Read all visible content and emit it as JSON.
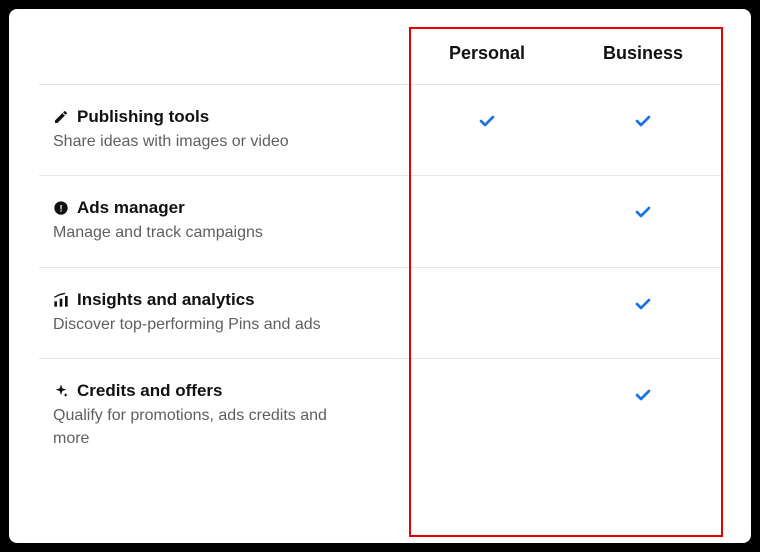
{
  "columns": {
    "personal": "Personal",
    "business": "Business"
  },
  "features": [
    {
      "icon": "pencil-icon",
      "title": "Publishing tools",
      "subtitle": "Share ideas with images or video",
      "personal": true,
      "business": true
    },
    {
      "icon": "megaphone-icon",
      "title": "Ads manager",
      "subtitle": "Manage and track campaigns",
      "personal": false,
      "business": true
    },
    {
      "icon": "analytics-icon",
      "title": "Insights and analytics",
      "subtitle": "Discover top-performing Pins and ads",
      "personal": false,
      "business": true
    },
    {
      "icon": "sparkle-icon",
      "title": "Credits and offers",
      "subtitle": "Qualify for promotions, ads credits and more",
      "personal": false,
      "business": true
    }
  ]
}
